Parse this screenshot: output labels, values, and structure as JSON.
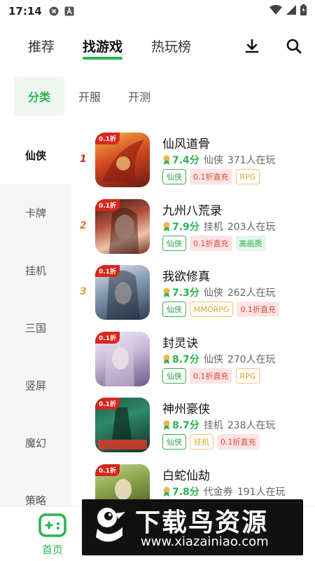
{
  "status_bar": {
    "time": "17:14"
  },
  "top_nav": {
    "tabs": [
      {
        "label": "推荐"
      },
      {
        "label": "找游戏"
      },
      {
        "label": "热玩榜"
      }
    ],
    "active_tab": "找游戏",
    "icons": [
      "download-icon",
      "search-icon"
    ]
  },
  "sub_tabs": {
    "items": [
      {
        "label": "分类"
      },
      {
        "label": "开服"
      },
      {
        "label": "开测"
      }
    ],
    "active": "分类"
  },
  "categories": [
    {
      "label": "仙侠"
    },
    {
      "label": "卡牌"
    },
    {
      "label": "挂机"
    },
    {
      "label": "三国"
    },
    {
      "label": "竖屏"
    },
    {
      "label": "魔幻"
    },
    {
      "label": "策略"
    }
  ],
  "active_category": "仙侠",
  "games": [
    {
      "rank": "1",
      "badge": "0.1折",
      "name": "仙风道骨",
      "score": "7.4分",
      "category": "仙侠",
      "players": "371人在玩",
      "tags": [
        {
          "text": "仙侠",
          "style": "green"
        },
        {
          "text": "0.1折直充",
          "style": "red"
        },
        {
          "text": "RPG",
          "style": "orange"
        }
      ]
    },
    {
      "rank": "2",
      "badge": "0.1折",
      "name": "九州八荒录",
      "score": "7.9分",
      "category": "挂机",
      "players": "203人在玩",
      "tags": [
        {
          "text": "仙侠",
          "style": "green"
        },
        {
          "text": "0.1折直充",
          "style": "red"
        },
        {
          "text": "高画质",
          "style": "lgreen"
        }
      ]
    },
    {
      "rank": "3",
      "badge": "0.1折",
      "name": "我欲修真",
      "score": "7.3分",
      "category": "仙侠",
      "players": "262人在玩",
      "tags": [
        {
          "text": "仙侠",
          "style": "green"
        },
        {
          "text": "MMORPG",
          "style": "orange"
        },
        {
          "text": "0.1折直充",
          "style": "red"
        }
      ]
    },
    {
      "rank": "",
      "badge": "0.1折",
      "name": "封灵诀",
      "score": "8.7分",
      "category": "仙侠",
      "players": "270人在玩",
      "tags": [
        {
          "text": "仙侠",
          "style": "green"
        },
        {
          "text": "0.1折直充",
          "style": "red"
        },
        {
          "text": "RPG",
          "style": "orange"
        }
      ]
    },
    {
      "rank": "",
      "badge": "0.1折",
      "name": "神州豪侠",
      "score": "8.7分",
      "category": "挂机",
      "players": "238人在玩",
      "tags": [
        {
          "text": "仙侠",
          "style": "green"
        },
        {
          "text": "挂机",
          "style": "orange"
        },
        {
          "text": "0.1折直充",
          "style": "red"
        }
      ]
    },
    {
      "rank": "",
      "badge": "0.1折",
      "name": "白蛇仙劫",
      "score": "7.8分",
      "category": "代金券",
      "players": "191人在玩",
      "tags": []
    }
  ],
  "bottom_nav": {
    "home_label": "首页"
  },
  "watermark": {
    "title": "下载鸟资源",
    "url": "www.xiazainiao.com"
  },
  "colors": {
    "accent": "#27b351",
    "rank1": "#d7261b",
    "rank2": "#e8762b",
    "rank3": "#e8a52b"
  }
}
